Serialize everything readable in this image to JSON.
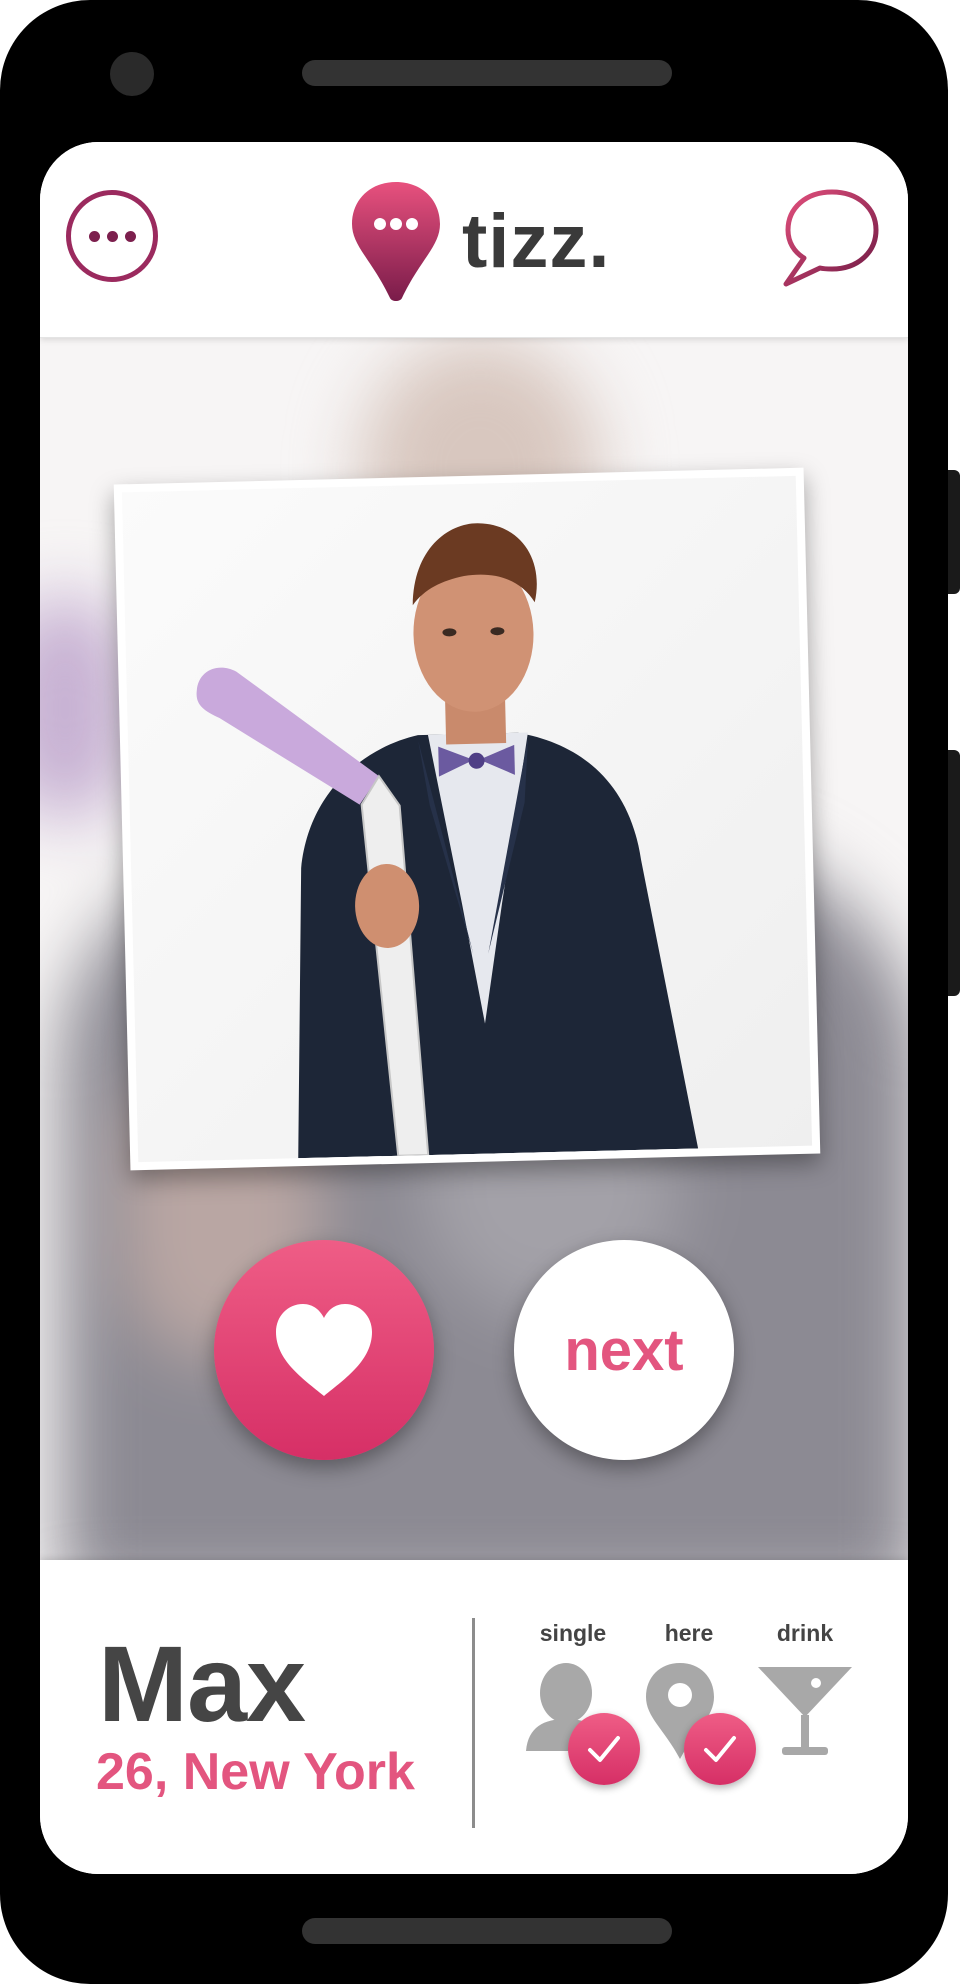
{
  "app": {
    "name": "tizz.",
    "brand_color": "#d62f66",
    "brand_dark": "#7c1f4d"
  },
  "header": {
    "menu_icon": "more-dots-icon",
    "chat_icon": "chat-bubble-icon",
    "logo_icon": "location-pin-chat-icon"
  },
  "actions": {
    "like_icon": "heart-icon",
    "next_label": "next"
  },
  "profile": {
    "name": "Max",
    "details": "26, New York"
  },
  "status": [
    {
      "label": "single",
      "icon": "person-icon",
      "checked": true
    },
    {
      "label": "here",
      "icon": "location-pin-icon",
      "checked": true
    },
    {
      "label": "drink",
      "icon": "cocktail-glass-icon",
      "checked": false
    }
  ]
}
